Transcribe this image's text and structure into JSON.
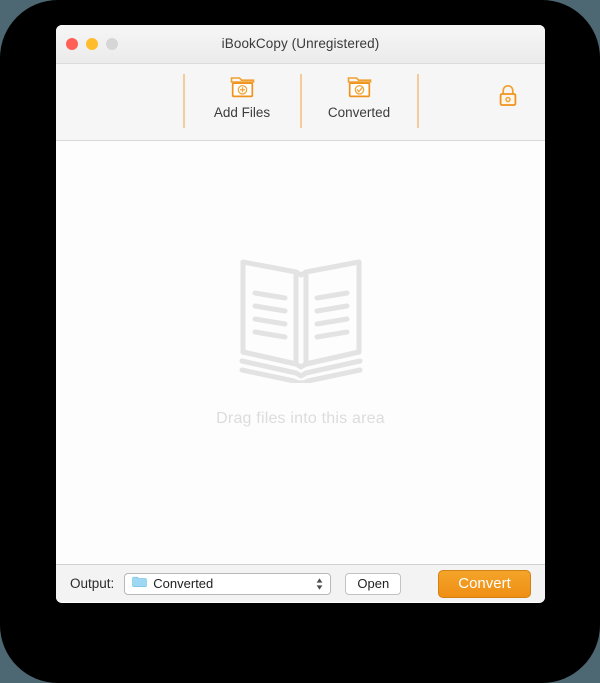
{
  "window": {
    "title": "iBookCopy (Unregistered)",
    "traffic_lights": [
      {
        "name": "close",
        "color": "#ff5f56"
      },
      {
        "name": "minimize",
        "color": "#ffbd2e"
      },
      {
        "name": "zoom",
        "color": "#d6d6d6"
      }
    ]
  },
  "toolbar": {
    "accent_color": "#f2a33c",
    "items": [
      {
        "id": "add-files",
        "label": "Add Files",
        "icon": "folder-plus-icon"
      },
      {
        "id": "converted",
        "label": "Converted",
        "icon": "folder-check-icon"
      }
    ],
    "lock": {
      "icon": "lock-closed-icon",
      "color": "#f2a33c"
    }
  },
  "drop_area": {
    "hint": "Drag files into this area",
    "illustration": "open-book-icon",
    "illustration_color": "#e2e2e2"
  },
  "footer": {
    "output_label": "Output:",
    "output_select": {
      "value": "Converted",
      "icon": "folder-icon",
      "icon_color": "#93d3f0"
    },
    "open_label": "Open",
    "convert_label": "Convert",
    "convert_color": "#ef8f14"
  }
}
